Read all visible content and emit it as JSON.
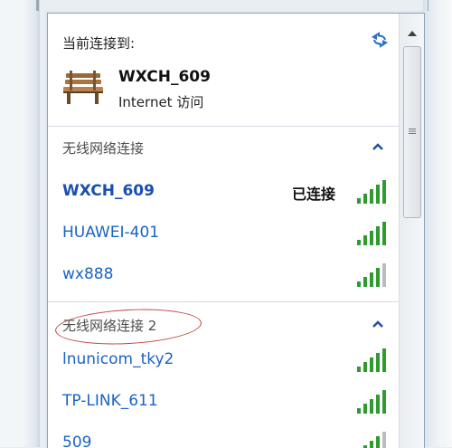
{
  "current": {
    "heading": "当前连接到:",
    "network_name": "WXCH_609",
    "status": "Internet 访问",
    "icon": "bench-network-icon"
  },
  "groups": [
    {
      "label": "无线网络连接",
      "networks": [
        {
          "name": "WXCH_609",
          "status": "已连接",
          "signal": 5
        },
        {
          "name": "HUAWEI-401",
          "status": "",
          "signal": 5
        },
        {
          "name": "wx888",
          "status": "",
          "signal": 4
        }
      ]
    },
    {
      "label": "无线网络连接 2",
      "networks": [
        {
          "name": "lnunicom_tky2",
          "status": "",
          "signal": 5
        },
        {
          "name": "TP-LINK_611",
          "status": "",
          "signal": 5
        },
        {
          "name": "509",
          "status": "",
          "signal": 4
        }
      ]
    }
  ],
  "icons": {
    "refresh": "refresh-icon",
    "collapse": "caret-up-icon",
    "signal": "wifi-signal-icon"
  },
  "colors": {
    "link_blue": "#1a63c8",
    "signal_green": "#2f9b2f",
    "annotation_red": "#c0443b"
  }
}
